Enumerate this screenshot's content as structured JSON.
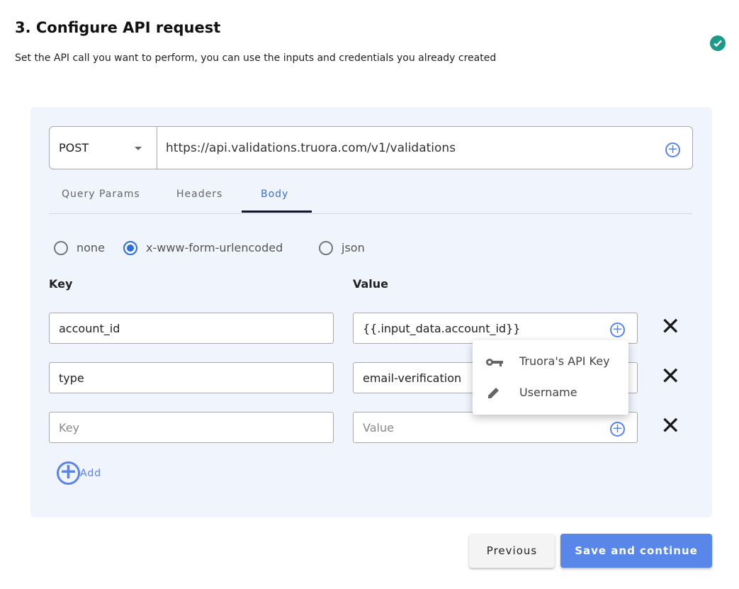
{
  "header": {
    "title": "3. Configure API request",
    "subtitle": "Set the API call you want to perform, you can use the inputs and credentials you already created",
    "status_icon": "check-circle-icon",
    "status_color": "#1b9a87"
  },
  "request": {
    "method": "POST",
    "url": "https://api.validations.truora.com/v1/validations"
  },
  "tabs": [
    {
      "label": "Query Params"
    },
    {
      "label": "Headers"
    },
    {
      "label": "Body",
      "active": true
    }
  ],
  "body_type": {
    "options": [
      "none",
      "x-www-form-urlencoded",
      "json"
    ],
    "selected": "x-www-form-urlencoded"
  },
  "columns": {
    "key": "Key",
    "value": "Value"
  },
  "rows": [
    {
      "key": "account_id",
      "value": "{{.input_data.account_id}}"
    },
    {
      "key": "type",
      "value": "email-verification"
    },
    {
      "key": "",
      "value": "",
      "key_placeholder": "Key",
      "value_placeholder": "Value"
    }
  ],
  "popup_menu": {
    "items": [
      {
        "label": "Truora's API Key",
        "icon": "key-icon"
      },
      {
        "label": "Username",
        "icon": "pencil-icon"
      }
    ]
  },
  "add_label": "Add",
  "buttons": {
    "previous": "Previous",
    "save": "Save and continue"
  },
  "colors": {
    "accent": "#5886e9",
    "panel": "#f0f4fc"
  }
}
